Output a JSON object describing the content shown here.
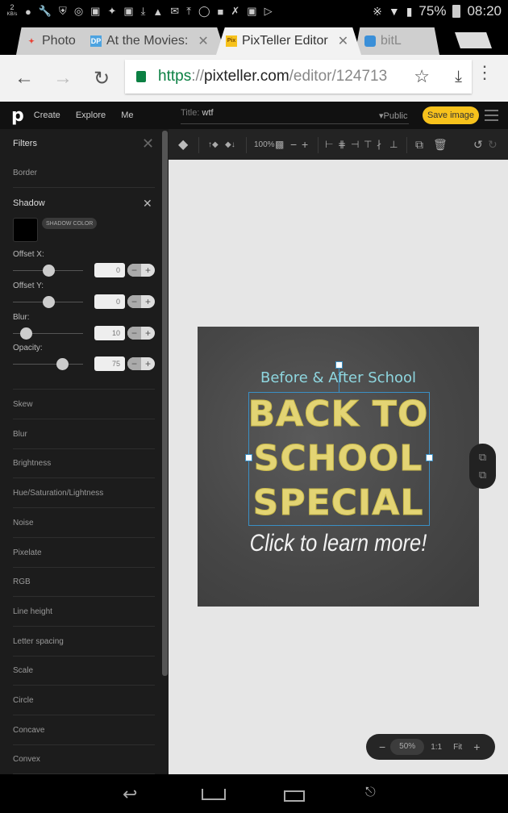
{
  "status_bar": {
    "kb_rate": "2",
    "kb_unit": "KB/s",
    "notification_icons": [
      "keyhole-icon",
      "wrench-icon",
      "shield-icon",
      "instagram-icon",
      "chat-icon",
      "twitter-icon",
      "image-icon",
      "download-icon",
      "warning-icon",
      "gmail-icon",
      "upload-icon",
      "alert-shield-icon",
      "lock-icon",
      "missed-call-icon",
      "app-icon",
      "play-store-icon"
    ],
    "battery": "75%",
    "time": "08:20"
  },
  "tabs": [
    {
      "label": "Photo",
      "favicon": "photos-icon",
      "active": false
    },
    {
      "label": "At the Movies:",
      "favicon": "DP",
      "active": false
    },
    {
      "label": "PixTeller Editor",
      "favicon": "Pix",
      "active": true
    },
    {
      "label": "bitL",
      "favicon": "bitlab-icon",
      "active": false
    }
  ],
  "omnibox": {
    "scheme": "https",
    "separator": "://",
    "host": "pixteller.com",
    "path": "/editor/124713"
  },
  "app": {
    "logo": "p",
    "nav": [
      "Create",
      "Explore",
      "Me"
    ],
    "title_label": "Title:",
    "title_value": "wtf",
    "visibility": "▾Public",
    "save_label": "Save image"
  },
  "toolbar": {
    "zoom": "100%"
  },
  "sidebar": {
    "header": "Filters",
    "border_label": "Border",
    "shadow": {
      "label": "Shadow",
      "color_label": "SHADOW COLOR",
      "color": "#000000",
      "controls": [
        {
          "label": "Offset X:",
          "value": "0",
          "position": 0.5
        },
        {
          "label": "Offset Y:",
          "value": "0",
          "position": 0.5
        },
        {
          "label": "Blur:",
          "value": "10",
          "position": 0.18
        },
        {
          "label": "Opacity:",
          "value": "75",
          "position": 0.7
        }
      ]
    },
    "items": [
      "Skew",
      "Blur",
      "Brightness",
      "Hue/Saturation/Lightness",
      "Noise",
      "Pixelate",
      "RGB",
      "Line height",
      "Letter spacing",
      "Scale",
      "Circle",
      "Concave",
      "Convex"
    ]
  },
  "artboard": {
    "pre_title": "Before & After School",
    "line1": "BACK TO",
    "line2": "SCHOOL",
    "line3": "SPECIAL",
    "cta": "Click to learn more!"
  },
  "zoombar": {
    "minus": "−",
    "value": "50%",
    "one_to_one": "1:1",
    "fit": "Fit",
    "plus": "+"
  },
  "colors": {
    "accent": "#f7c21c",
    "selection": "#3a8fc4",
    "chalk_yellow": "#e3d474",
    "chalk_blue": "#8ed6df"
  }
}
